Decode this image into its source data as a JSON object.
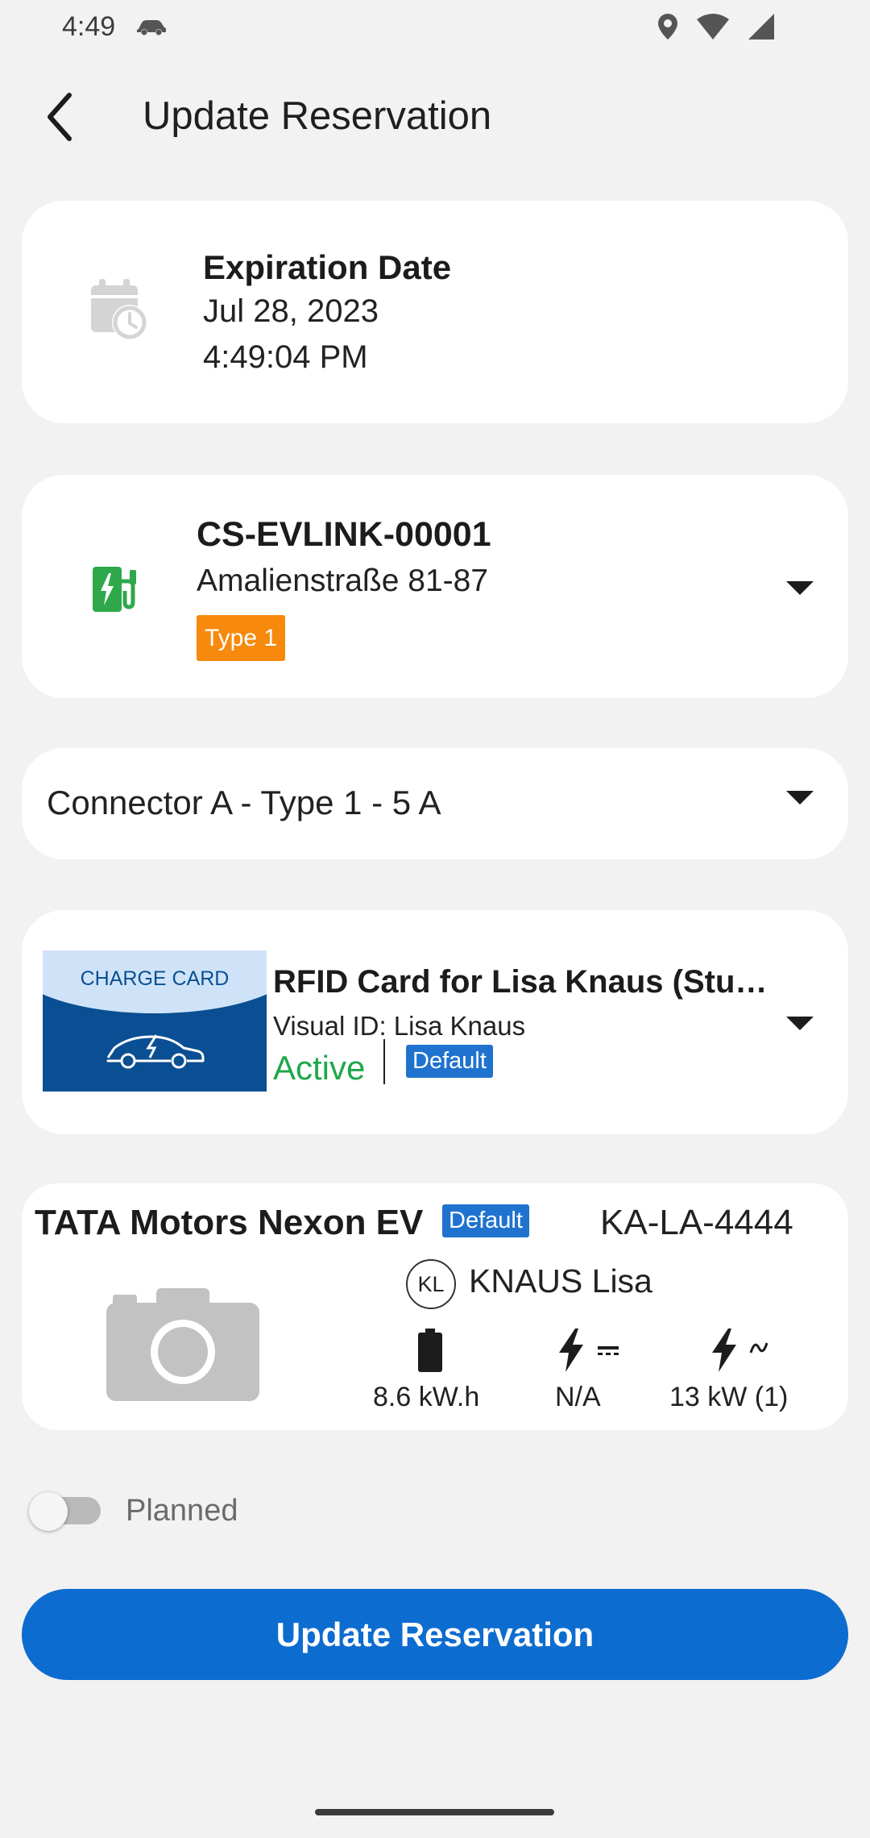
{
  "status_bar": {
    "time": "4:49"
  },
  "header": {
    "title": "Update Reservation"
  },
  "expiration": {
    "label": "Expiration Date",
    "date": "Jul 28, 2023",
    "time": "4:49:04 PM"
  },
  "station": {
    "id": "CS-EVLINK-00001",
    "address": "Amalienstraße 81-87",
    "type_badge": "Type 1"
  },
  "connector": {
    "value": "Connector A - Type 1 - 5 A"
  },
  "card": {
    "image_label": "CHARGE CARD",
    "name": "RFID Card for Lisa Knaus (Stu…",
    "visual_id": "Visual ID: Lisa Knaus",
    "status": "Active",
    "default_badge": "Default"
  },
  "vehicle": {
    "name": "TATA Motors Nexon EV",
    "default_badge": "Default",
    "plate": "KA-LA-4444",
    "owner_initials": "KL",
    "owner_name": "KNAUS Lisa",
    "battery": "8.6 kW.h",
    "dc_power": "N/A",
    "ac_power": "13 kW (1)"
  },
  "planned_toggle": {
    "label": "Planned",
    "on": false
  },
  "update_button": {
    "label": "Update Reservation"
  },
  "colors": {
    "primary": "#0d6ccf",
    "active_green": "#1fa84a",
    "type_orange": "#f7890c",
    "badge_blue": "#1f73cf",
    "fuel_green": "#2ea84a"
  },
  "icons": {
    "status_left": [
      "car-icon"
    ],
    "status_right": [
      "location-icon",
      "wifi-icon",
      "signal-icon"
    ],
    "header": "back-arrow-icon",
    "expiration": "calendar-clock-icon",
    "station": "ev-station-icon",
    "vehicle_image": "camera-icon",
    "specs": [
      "battery-icon",
      "dc-power-icon",
      "ac-power-icon"
    ]
  }
}
